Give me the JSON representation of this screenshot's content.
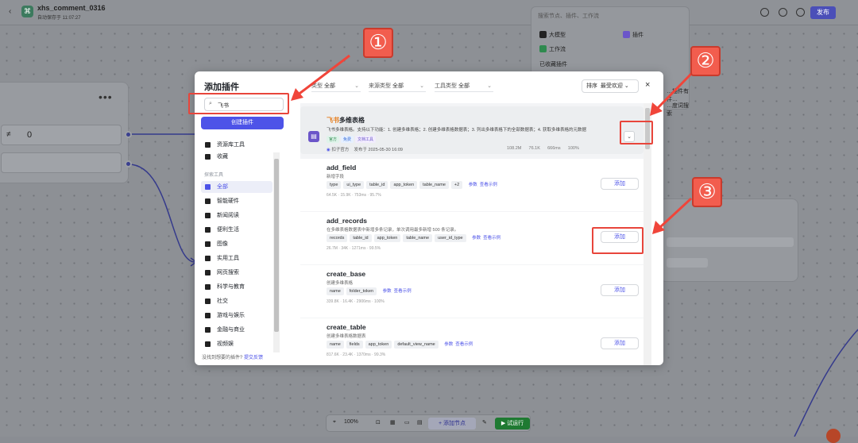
{
  "topbar": {
    "back": "‹",
    "title": "xhs_comment_0316",
    "subtitle": "自动保存于 11:07:27",
    "publish": "发布"
  },
  "canvas_node": {
    "dots": "•••",
    "ne_symbol": "≠",
    "value": "0"
  },
  "right_panel": {
    "search_placeholder": "搜索节点、插件、工作流",
    "items": [
      "大模型",
      "插件",
      "工作流",
      "已收藏插件"
    ],
    "line1": "…插件有件…",
    "line2": "…度词搜索"
  },
  "bottombar": {
    "zoom": "100%",
    "add_node": "+ 添加节点",
    "trial": "▶ 试运行"
  },
  "dialog": {
    "title": "添加插件",
    "search_value": "飞书",
    "create_plugin": "创建插件",
    "close": "×",
    "filters": [
      {
        "label": "类型",
        "value": "全部"
      },
      {
        "label": "来源类型",
        "value": "全部"
      },
      {
        "label": "工具类型",
        "value": "全部"
      }
    ],
    "sort_label": "排序",
    "sort_value": "最受欢迎",
    "sidebar": {
      "top_items": [
        "资源库工具",
        "收藏"
      ],
      "section": "探索工具",
      "items": [
        "全部",
        "智能硬件",
        "新闻阅读",
        "便利生活",
        "图像",
        "实用工具",
        "网页搜索",
        "科学与教育",
        "社交",
        "游戏与娱乐",
        "金融与商业",
        "视频娱"
      ],
      "active_index": 0,
      "footer_text": "没找到想要的插件?",
      "footer_link": "提交反馈"
    },
    "plugin": {
      "name_highlight": "飞书",
      "name_rest": "多维表格",
      "description": "飞书多维表格。支持以下功能：1. 创建多维表格；2. 创建多维表格数据表；3. 列出多维表格下的全部数据表；4. 获取多维表格的元数据",
      "tags": [
        "官方",
        "免费",
        "文档工具"
      ],
      "author": "扣子官方",
      "date": "发布于 2025-05-30 16:09",
      "stats": [
        "108.2M",
        "76.1K",
        "666ms",
        "100%"
      ],
      "expand": "⌄"
    },
    "tools": [
      {
        "name": "add_field",
        "desc": "新增字段",
        "params": [
          "type",
          "ui_type",
          "table_id",
          "app_token",
          "table_name",
          "+2"
        ],
        "stats": "64.5K · 15.9K · 753ms · 95.7%"
      },
      {
        "name": "add_records",
        "desc": "在多维表格数据表中新增多条记录，单次调用最多新增 500 条记录。",
        "params": [
          "records",
          "table_id",
          "app_token",
          "table_name",
          "user_id_type"
        ],
        "stats": "26.7M · 34K · 1271ms · 99.5%"
      },
      {
        "name": "create_base",
        "desc": "创建多维表格",
        "params": [
          "name",
          "folder_token"
        ],
        "stats": "339.8K · 16.4K · 2906ms · 100%"
      },
      {
        "name": "create_table",
        "desc": "创建多维表格数据表",
        "params": [
          "name",
          "fields",
          "app_token",
          "default_view_name"
        ],
        "stats": "817.6K · 23.4K · 1370ms · 99.3%"
      }
    ],
    "param_link": "参数",
    "example_link": "查看示例",
    "add_label": "添加"
  },
  "annotations": [
    "①",
    "②",
    "③"
  ]
}
